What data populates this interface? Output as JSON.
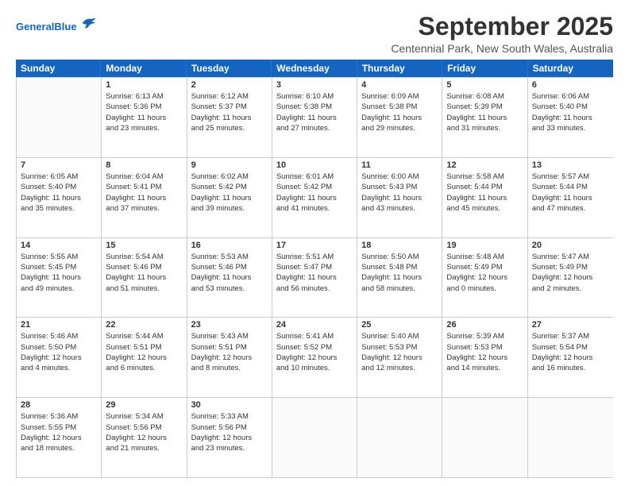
{
  "header": {
    "logo_line1": "General",
    "logo_line2": "Blue",
    "title": "September 2025",
    "subtitle": "Centennial Park, New South Wales, Australia"
  },
  "days_of_week": [
    "Sunday",
    "Monday",
    "Tuesday",
    "Wednesday",
    "Thursday",
    "Friday",
    "Saturday"
  ],
  "weeks": [
    [
      {
        "day": "",
        "lines": []
      },
      {
        "day": "1",
        "lines": [
          "Sunrise: 6:13 AM",
          "Sunset: 5:36 PM",
          "Daylight: 11 hours",
          "and 23 minutes."
        ]
      },
      {
        "day": "2",
        "lines": [
          "Sunrise: 6:12 AM",
          "Sunset: 5:37 PM",
          "Daylight: 11 hours",
          "and 25 minutes."
        ]
      },
      {
        "day": "3",
        "lines": [
          "Sunrise: 6:10 AM",
          "Sunset: 5:38 PM",
          "Daylight: 11 hours",
          "and 27 minutes."
        ]
      },
      {
        "day": "4",
        "lines": [
          "Sunrise: 6:09 AM",
          "Sunset: 5:38 PM",
          "Daylight: 11 hours",
          "and 29 minutes."
        ]
      },
      {
        "day": "5",
        "lines": [
          "Sunrise: 6:08 AM",
          "Sunset: 5:39 PM",
          "Daylight: 11 hours",
          "and 31 minutes."
        ]
      },
      {
        "day": "6",
        "lines": [
          "Sunrise: 6:06 AM",
          "Sunset: 5:40 PM",
          "Daylight: 11 hours",
          "and 33 minutes."
        ]
      }
    ],
    [
      {
        "day": "7",
        "lines": [
          "Sunrise: 6:05 AM",
          "Sunset: 5:40 PM",
          "Daylight: 11 hours",
          "and 35 minutes."
        ]
      },
      {
        "day": "8",
        "lines": [
          "Sunrise: 6:04 AM",
          "Sunset: 5:41 PM",
          "Daylight: 11 hours",
          "and 37 minutes."
        ]
      },
      {
        "day": "9",
        "lines": [
          "Sunrise: 6:02 AM",
          "Sunset: 5:42 PM",
          "Daylight: 11 hours",
          "and 39 minutes."
        ]
      },
      {
        "day": "10",
        "lines": [
          "Sunrise: 6:01 AM",
          "Sunset: 5:42 PM",
          "Daylight: 11 hours",
          "and 41 minutes."
        ]
      },
      {
        "day": "11",
        "lines": [
          "Sunrise: 6:00 AM",
          "Sunset: 5:43 PM",
          "Daylight: 11 hours",
          "and 43 minutes."
        ]
      },
      {
        "day": "12",
        "lines": [
          "Sunrise: 5:58 AM",
          "Sunset: 5:44 PM",
          "Daylight: 11 hours",
          "and 45 minutes."
        ]
      },
      {
        "day": "13",
        "lines": [
          "Sunrise: 5:57 AM",
          "Sunset: 5:44 PM",
          "Daylight: 11 hours",
          "and 47 minutes."
        ]
      }
    ],
    [
      {
        "day": "14",
        "lines": [
          "Sunrise: 5:55 AM",
          "Sunset: 5:45 PM",
          "Daylight: 11 hours",
          "and 49 minutes."
        ]
      },
      {
        "day": "15",
        "lines": [
          "Sunrise: 5:54 AM",
          "Sunset: 5:46 PM",
          "Daylight: 11 hours",
          "and 51 minutes."
        ]
      },
      {
        "day": "16",
        "lines": [
          "Sunrise: 5:53 AM",
          "Sunset: 5:46 PM",
          "Daylight: 11 hours",
          "and 53 minutes."
        ]
      },
      {
        "day": "17",
        "lines": [
          "Sunrise: 5:51 AM",
          "Sunset: 5:47 PM",
          "Daylight: 11 hours",
          "and 56 minutes."
        ]
      },
      {
        "day": "18",
        "lines": [
          "Sunrise: 5:50 AM",
          "Sunset: 5:48 PM",
          "Daylight: 11 hours",
          "and 58 minutes."
        ]
      },
      {
        "day": "19",
        "lines": [
          "Sunrise: 5:48 AM",
          "Sunset: 5:49 PM",
          "Daylight: 12 hours",
          "and 0 minutes."
        ]
      },
      {
        "day": "20",
        "lines": [
          "Sunrise: 5:47 AM",
          "Sunset: 5:49 PM",
          "Daylight: 12 hours",
          "and 2 minutes."
        ]
      }
    ],
    [
      {
        "day": "21",
        "lines": [
          "Sunrise: 5:46 AM",
          "Sunset: 5:50 PM",
          "Daylight: 12 hours",
          "and 4 minutes."
        ]
      },
      {
        "day": "22",
        "lines": [
          "Sunrise: 5:44 AM",
          "Sunset: 5:51 PM",
          "Daylight: 12 hours",
          "and 6 minutes."
        ]
      },
      {
        "day": "23",
        "lines": [
          "Sunrise: 5:43 AM",
          "Sunset: 5:51 PM",
          "Daylight: 12 hours",
          "and 8 minutes."
        ]
      },
      {
        "day": "24",
        "lines": [
          "Sunrise: 5:41 AM",
          "Sunset: 5:52 PM",
          "Daylight: 12 hours",
          "and 10 minutes."
        ]
      },
      {
        "day": "25",
        "lines": [
          "Sunrise: 5:40 AM",
          "Sunset: 5:53 PM",
          "Daylight: 12 hours",
          "and 12 minutes."
        ]
      },
      {
        "day": "26",
        "lines": [
          "Sunrise: 5:39 AM",
          "Sunset: 5:53 PM",
          "Daylight: 12 hours",
          "and 14 minutes."
        ]
      },
      {
        "day": "27",
        "lines": [
          "Sunrise: 5:37 AM",
          "Sunset: 5:54 PM",
          "Daylight: 12 hours",
          "and 16 minutes."
        ]
      }
    ],
    [
      {
        "day": "28",
        "lines": [
          "Sunrise: 5:36 AM",
          "Sunset: 5:55 PM",
          "Daylight: 12 hours",
          "and 18 minutes."
        ]
      },
      {
        "day": "29",
        "lines": [
          "Sunrise: 5:34 AM",
          "Sunset: 5:56 PM",
          "Daylight: 12 hours",
          "and 21 minutes."
        ]
      },
      {
        "day": "30",
        "lines": [
          "Sunrise: 5:33 AM",
          "Sunset: 5:56 PM",
          "Daylight: 12 hours",
          "and 23 minutes."
        ]
      },
      {
        "day": "",
        "lines": []
      },
      {
        "day": "",
        "lines": []
      },
      {
        "day": "",
        "lines": []
      },
      {
        "day": "",
        "lines": []
      }
    ]
  ]
}
